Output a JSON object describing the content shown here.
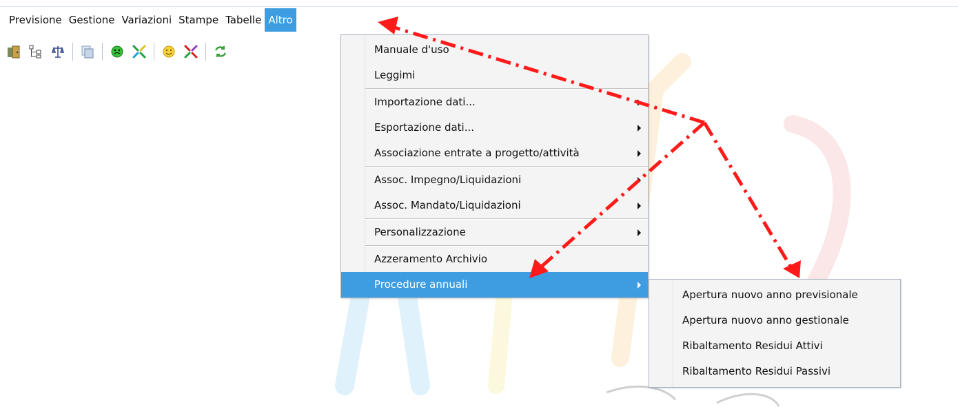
{
  "menubar": {
    "items": [
      {
        "label": "Previsione"
      },
      {
        "label": "Gestione"
      },
      {
        "label": "Variazioni"
      },
      {
        "label": "Stampe"
      },
      {
        "label": "Tabelle"
      },
      {
        "label": "Altro"
      }
    ]
  },
  "toolbar": {
    "icons": [
      "exit-door-icon",
      "tree-structure-icon",
      "balance-scale-icon",
      "copy-pages-icon",
      "green-face-icon",
      "green-arrows-in-icon",
      "smiley-face-icon",
      "red-arrows-out-icon",
      "refresh-icon"
    ]
  },
  "altro_menu": {
    "items": [
      {
        "label": "Manuale d'uso"
      },
      {
        "label": "Leggimi"
      },
      {
        "label": "Importazione dati..."
      },
      {
        "label": "Esportazione dati..."
      },
      {
        "label": "Associazione entrate a progetto/attività"
      },
      {
        "label": "Assoc. Impegno/Liquidazioni"
      },
      {
        "label": "Assoc. Mandato/Liquidazioni"
      },
      {
        "label": "Personalizzazione"
      },
      {
        "label": "Azzeramento Archivio"
      },
      {
        "label": "Procedure annuali"
      }
    ]
  },
  "procedure_submenu": {
    "items": [
      {
        "label": "Apertura nuovo anno previsionale"
      },
      {
        "label": "Apertura nuovo anno gestionale"
      },
      {
        "label": "Ribaltamento Residui Attivi"
      },
      {
        "label": "Ribaltamento Residui Passivi"
      }
    ]
  },
  "colors": {
    "highlight": "#3d9de0",
    "annotation_arrow": "#ff1a1a"
  }
}
